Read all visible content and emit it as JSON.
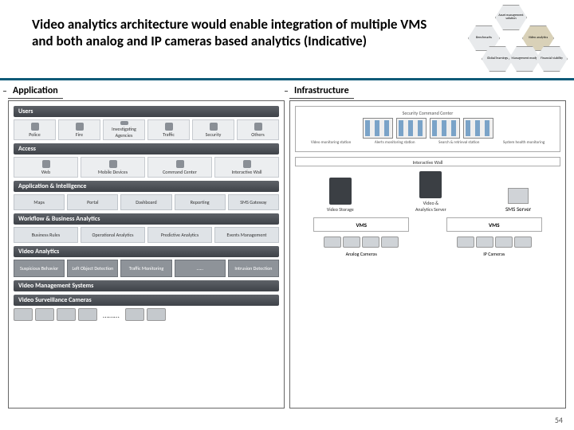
{
  "title": "Video analytics architecture would enable integration of multiple VMS and both analog and IP cameras based analytics (Indicative)",
  "hex": {
    "a": "Asset management solution",
    "b": "Benchmarks",
    "c": "Video analytics",
    "d": "Global learnings",
    "e": "Management model",
    "f": "Financial viability"
  },
  "left": {
    "title": "Application",
    "users_bar": "Users",
    "users": [
      "Police",
      "Fire",
      "Investigating Agencies",
      "Traffic",
      "Security",
      "Others"
    ],
    "access_bar": "Access",
    "access": [
      "Web",
      "Mobile Devices",
      "Command Center",
      "Interactive Wall"
    ],
    "app_bar": "Application & Intelligence",
    "app": [
      "Maps",
      "Portal",
      "Dashboard",
      "Reporting",
      "SMS Gateway"
    ],
    "wf_bar": "Workflow & Business Analytics",
    "wf": [
      "Business Rules",
      "Operational Analytics",
      "Predictive Analytics",
      "Events Management"
    ],
    "va_bar": "Video Analytics",
    "va": [
      "Suspicious Behavior",
      "Left Object Detection",
      "Traffic Monitoring",
      "……",
      "Intrusion Detection"
    ],
    "vms_bar": "Video Management Systems",
    "cam_bar": "Video Surveillance Cameras",
    "cam_dots": "………"
  },
  "right": {
    "title": "Infrastructure",
    "scc": "Security Command Center",
    "p1": "Video monitoring station",
    "p2": "Alerts monitoring station",
    "p3": "Search & retrieval station",
    "p4": "System health monitoring",
    "iw": "Interactive Wall",
    "srv1": "Video Storage",
    "srv2": "Video & Analytics Server",
    "sms": "SMS Server",
    "vms": "VMS",
    "cam_a": "Analog Cameras",
    "cam_b": "IP Cameras"
  },
  "page": "54"
}
